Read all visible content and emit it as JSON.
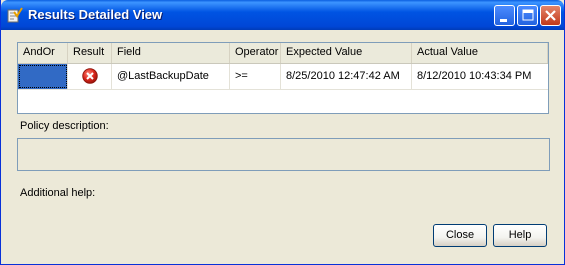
{
  "window": {
    "title": "Results Detailed View",
    "icon": "policy-check-icon"
  },
  "title_buttons": {
    "minimize_icon": "minimize-icon",
    "maximize_icon": "maximize-icon",
    "close_icon": "close-icon"
  },
  "grid": {
    "columns": [
      "AndOr",
      "Result",
      "Field",
      "Operator",
      "Expected Value",
      "Actual Value"
    ],
    "rows": [
      {
        "andor": "",
        "result_icon": "error-icon",
        "field": "@LastBackupDate",
        "operator": ">=",
        "expected": "8/25/2010 12:47:42 AM",
        "actual": "8/12/2010 10:43:34 PM"
      }
    ],
    "selection_color": "#316ac5"
  },
  "policy_description": {
    "label": "Policy description:",
    "value": ""
  },
  "additional_help": {
    "label": "Additional help:"
  },
  "buttons": {
    "close": "Close",
    "help": "Help"
  },
  "colors": {
    "titlebar": "#0054e3",
    "error": "#d9261c",
    "face": "#ece9d8"
  }
}
